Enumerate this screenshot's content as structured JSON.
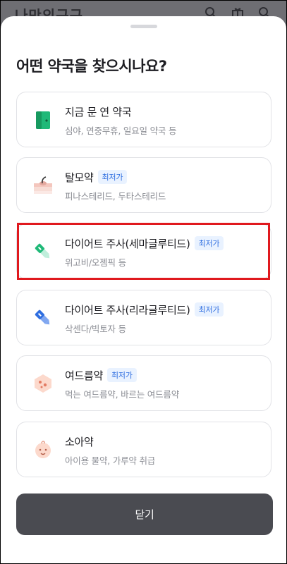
{
  "background_app": {
    "logo_text": "나만의구구",
    "icons": [
      "search-icon",
      "gift-icon",
      "search-icon"
    ]
  },
  "sheet": {
    "title": "어떤 약국을 찾으시나요?",
    "close_label": "닫기"
  },
  "options": [
    {
      "name": "지금 문 연 약국",
      "badge": "",
      "desc": "심야, 연중무휴, 일요일 약국 등",
      "icon": "door-icon"
    },
    {
      "name": "탈모약",
      "badge": "최저가",
      "desc": "피나스테리드, 두타스테리드",
      "icon": "hair-scalp-icon"
    },
    {
      "name": "다이어트 주사(세마글루티드)",
      "badge": "최저가",
      "desc": "위고비/오젬픽 등",
      "icon": "green-injection-pen-icon"
    },
    {
      "name": "다이어트 주사(리라글루티드)",
      "badge": "최저가",
      "desc": "삭센다/빅토자 등",
      "icon": "blue-injection-pen-icon"
    },
    {
      "name": "여드름약",
      "badge": "최저가",
      "desc": "먹는 여드름약, 바르는 여드름약",
      "icon": "acne-face-icon"
    },
    {
      "name": "소아약",
      "badge": "",
      "desc": "아이용 물약, 가루약 취급",
      "icon": "baby-face-icon"
    }
  ],
  "highlight_color": "#e0191e",
  "badge_color": "#2f6ee0"
}
